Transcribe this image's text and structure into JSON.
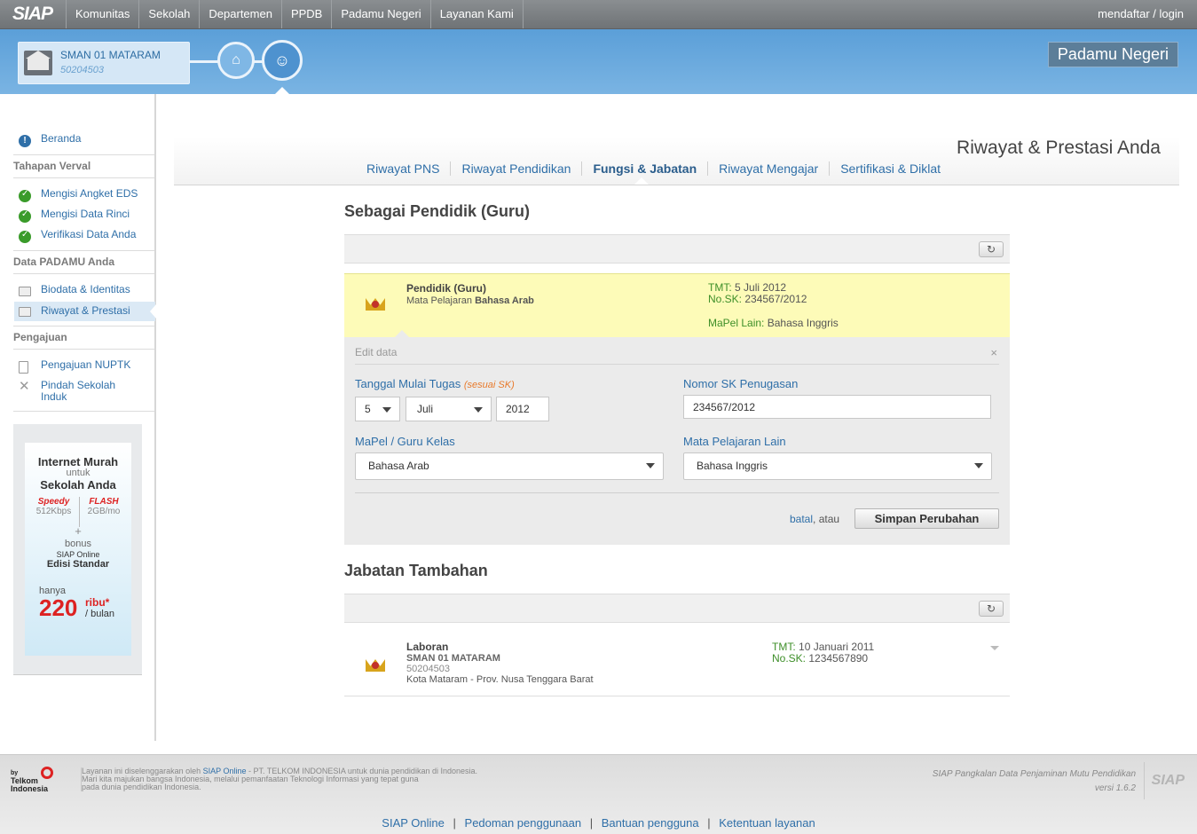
{
  "topbar": {
    "logo": "SIAP",
    "nav": [
      "Komunitas",
      "Sekolah",
      "Departemen",
      "PPDB",
      "Padamu Negeri",
      "Layanan Kami"
    ],
    "auth": "mendaftar / login"
  },
  "header": {
    "school_name": "SMAN 01 MATARAM",
    "school_id": "50204503",
    "brand": "Padamu Negeri"
  },
  "sidebar": {
    "beranda": "Beranda",
    "sec1": "Tahapan Verval",
    "verval": [
      "Mengisi Angket EDS",
      "Mengisi Data Rinci",
      "Verifikasi Data Anda"
    ],
    "sec2": "Data PADAMU Anda",
    "data": [
      "Biodata & Identitas",
      "Riwayat & Prestasi"
    ],
    "sec3": "Pengajuan",
    "pengajuan": [
      "Pengajuan NUPTK",
      "Pindah Sekolah Induk"
    ],
    "ad": {
      "line1": "Internet Murah",
      "line2": "untuk",
      "line3": "Sekolah Anda",
      "speedy": "Speedy",
      "speedy_rate": "512Kbps",
      "flash": "FLASH",
      "flash_rate": "2GB/mo",
      "plus": "+",
      "bonus": "bonus",
      "prod1": "SIAP Online",
      "prod2": "Edisi Standar",
      "hanya": "hanya",
      "price": "220",
      "ribu": "ribu*",
      "bulan": "/ bulan"
    }
  },
  "main": {
    "page_title": "Riwayat & Prestasi Anda",
    "tabs": [
      "Riwayat PNS",
      "Riwayat Pendidikan",
      "Fungsi & Jabatan",
      "Riwayat Mengajar",
      "Sertifikasi & Diklat"
    ],
    "sec1_title": "Sebagai Pendidik (Guru)",
    "card": {
      "title": "Pendidik (Guru)",
      "subtitle_prefix": "Mata Pelajaran",
      "subject": "Bahasa Arab",
      "tmt_label": "TMT:",
      "tmt": "5 Juli 2012",
      "nosk_label": "No.SK:",
      "nosk": "234567/2012",
      "mapel_lain_label": "MaPel Lain:",
      "mapel_lain": "Bahasa Inggris"
    },
    "edit": {
      "title": "Edit data",
      "close": "×",
      "tmt_label": "Tanggal Mulai Tugas",
      "tmt_note": "(sesuai SK)",
      "day": "5",
      "month": "Juli",
      "year": "2012",
      "sk_label": "Nomor SK Penugasan",
      "sk_value": "234567/2012",
      "mapel_label": "MaPel / Guru Kelas",
      "mapel_value": "Bahasa Arab",
      "lain_label": "Mata Pelajaran Lain",
      "lain_value": "Bahasa Inggris",
      "cancel": "batal",
      "cancel_suffix": ", atau",
      "save": "Simpan Perubahan"
    },
    "sec2_title": "Jabatan Tambahan",
    "jcard": {
      "title": "Laboran",
      "school": "SMAN 01 MATARAM",
      "school_id": "50204503",
      "location": "Kota Mataram - Prov. Nusa Tenggara Barat",
      "tmt_label": "TMT:",
      "tmt": "10 Januari 2011",
      "nosk_label": "No.SK:",
      "nosk": "1234567890"
    }
  },
  "footer": {
    "telkom": [
      "by",
      "Telkom",
      "Indonesia"
    ],
    "text1_pre": "Layanan ini diselenggarakan oleh",
    "text1_link": "SIAP Online",
    "text1_post": "- PT. TELKOM INDONESIA untuk dunia pendidikan di Indonesia.",
    "text2": "Mari kita majukan bangsa Indonesia, melalui pemanfaatan Teknologi Informasi yang tepat guna",
    "text3": "pada dunia pendidikan Indonesia.",
    "right1": "SIAP Pangkalan Data Penjaminan Mutu Pendidikan",
    "right2": "versi 1.6.2",
    "logo": "SIAP",
    "links": [
      "SIAP Online",
      "Pedoman penggunaan",
      "Bantuan pengguna",
      "Ketentuan layanan"
    ]
  },
  "colors": {
    "topbar": "#7a7e81",
    "header_blue": "#5b9fd8",
    "link": "#2f6fa8",
    "green_label": "#3e8f29",
    "card_yellow": "#fdfbb8"
  }
}
